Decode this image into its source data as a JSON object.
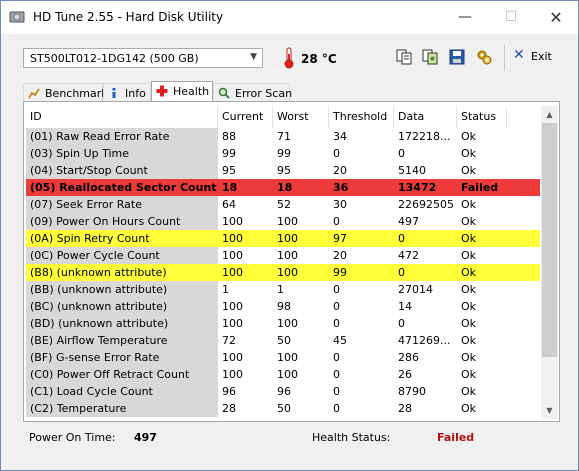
{
  "window": {
    "title": "HD Tune 2.55 - Hard Disk Utility",
    "minimize_glyph": "—",
    "maximize_glyph": "☐",
    "close_glyph": "✕"
  },
  "toolbar": {
    "drive": "ST500LT012-1DG142 (500 GB)",
    "temperature": "28 °C",
    "exit_label": "Exit",
    "icons": [
      "copy-text-icon",
      "copy-screenshot-icon",
      "save-icon",
      "options-icon"
    ]
  },
  "tabs": [
    {
      "label": "Benchmark",
      "icon": "benchmark-icon",
      "active": false
    },
    {
      "label": "Info",
      "icon": "info-icon",
      "active": false
    },
    {
      "label": "Health",
      "icon": "health-cross-icon",
      "active": true
    },
    {
      "label": "Error Scan",
      "icon": "magnifier-icon",
      "active": false
    }
  ],
  "table": {
    "columns": [
      "ID",
      "Current",
      "Worst",
      "Threshold",
      "Data",
      "Status"
    ],
    "rows": [
      {
        "id": "(01) Raw Read Error Rate",
        "current": "88",
        "worst": "71",
        "threshold": "34",
        "data": "172218...",
        "status": "Ok",
        "highlight": ""
      },
      {
        "id": "(03) Spin Up Time",
        "current": "99",
        "worst": "99",
        "threshold": "0",
        "data": "0",
        "status": "Ok",
        "highlight": ""
      },
      {
        "id": "(04) Start/Stop Count",
        "current": "95",
        "worst": "95",
        "threshold": "20",
        "data": "5140",
        "status": "Ok",
        "highlight": ""
      },
      {
        "id": "(05) Reallocated Sector Count",
        "current": "18",
        "worst": "18",
        "threshold": "36",
        "data": "13472",
        "status": "Failed",
        "highlight": "red"
      },
      {
        "id": "(07) Seek Error Rate",
        "current": "64",
        "worst": "52",
        "threshold": "30",
        "data": "22692505",
        "status": "Ok",
        "highlight": ""
      },
      {
        "id": "(09) Power On Hours Count",
        "current": "100",
        "worst": "100",
        "threshold": "0",
        "data": "497",
        "status": "Ok",
        "highlight": ""
      },
      {
        "id": "(0A) Spin Retry Count",
        "current": "100",
        "worst": "100",
        "threshold": "97",
        "data": "0",
        "status": "Ok",
        "highlight": "yellow"
      },
      {
        "id": "(0C) Power Cycle Count",
        "current": "100",
        "worst": "100",
        "threshold": "20",
        "data": "472",
        "status": "Ok",
        "highlight": ""
      },
      {
        "id": "(B8) (unknown attribute)",
        "current": "100",
        "worst": "100",
        "threshold": "99",
        "data": "0",
        "status": "Ok",
        "highlight": "yellow"
      },
      {
        "id": "(BB) (unknown attribute)",
        "current": "1",
        "worst": "1",
        "threshold": "0",
        "data": "27014",
        "status": "Ok",
        "highlight": ""
      },
      {
        "id": "(BC) (unknown attribute)",
        "current": "100",
        "worst": "98",
        "threshold": "0",
        "data": "14",
        "status": "Ok",
        "highlight": ""
      },
      {
        "id": "(BD) (unknown attribute)",
        "current": "100",
        "worst": "100",
        "threshold": "0",
        "data": "0",
        "status": "Ok",
        "highlight": ""
      },
      {
        "id": "(BE) Airflow Temperature",
        "current": "72",
        "worst": "50",
        "threshold": "45",
        "data": "471269...",
        "status": "Ok",
        "highlight": ""
      },
      {
        "id": "(BF) G-sense Error Rate",
        "current": "100",
        "worst": "100",
        "threshold": "0",
        "data": "286",
        "status": "Ok",
        "highlight": ""
      },
      {
        "id": "(C0) Power Off Retract Count",
        "current": "100",
        "worst": "100",
        "threshold": "0",
        "data": "26",
        "status": "Ok",
        "highlight": ""
      },
      {
        "id": "(C1) Load Cycle Count",
        "current": "96",
        "worst": "96",
        "threshold": "0",
        "data": "8790",
        "status": "Ok",
        "highlight": ""
      },
      {
        "id": "(C2) Temperature",
        "current": "28",
        "worst": "50",
        "threshold": "0",
        "data": "28",
        "status": "Ok",
        "highlight": ""
      }
    ]
  },
  "scrollbar": {
    "up_glyph": "▲",
    "down_glyph": "▼"
  },
  "status_bar": {
    "power_on_label": "Power On Time:",
    "power_on_value": "497",
    "health_label": "Health Status:",
    "health_value": "Failed",
    "health_color": "#b01010"
  },
  "colors": {
    "failed_row": "#ee3a3a",
    "warning_row": "#ffff3a",
    "exit_icon": "#1b4fb5"
  }
}
